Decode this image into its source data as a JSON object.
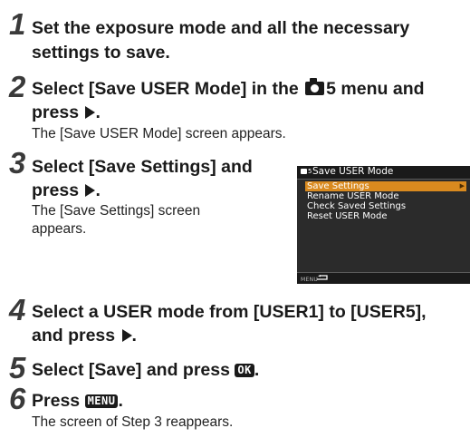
{
  "steps": [
    {
      "number": "1",
      "title_line1": "Set the exposure mode and all the necessary",
      "title_line2": "settings to save."
    },
    {
      "number": "2",
      "title_part1": "Select [Save USER Mode] in the",
      "title_part2": "5 menu and",
      "title_line2": "press",
      "body": "The [Save USER Mode] screen appears."
    },
    {
      "number": "3",
      "title_line1": "Select [Save Settings] and",
      "title_line2": "press",
      "body_line1": "The [Save Settings] screen",
      "body_line2": "appears."
    },
    {
      "number": "4",
      "title_line1": "Select a USER mode from [USER1] to [USER5],",
      "title_line2": "and press"
    },
    {
      "number": "5",
      "title_part1": "Select [Save] and press",
      "key": "OK",
      "title_end": "."
    },
    {
      "number": "6",
      "title_part1": "Press",
      "key": "MENU",
      "title_end": ".",
      "body": "The screen of Step 3 reappears."
    }
  ],
  "camera_screen": {
    "menu_number": "5",
    "title": "Save USER Mode",
    "items": [
      "Save Settings",
      "Rename USER Mode",
      "Check Saved Settings",
      "Reset USER Mode"
    ],
    "footer_label": "MENU",
    "highlight_color": "#d98a1f",
    "background_color": "#2b2b2b"
  },
  "icons": {
    "camera_menu": "camera-icon",
    "right_arrow": "right-triangle-icon",
    "back": "back-arrow-icon"
  }
}
